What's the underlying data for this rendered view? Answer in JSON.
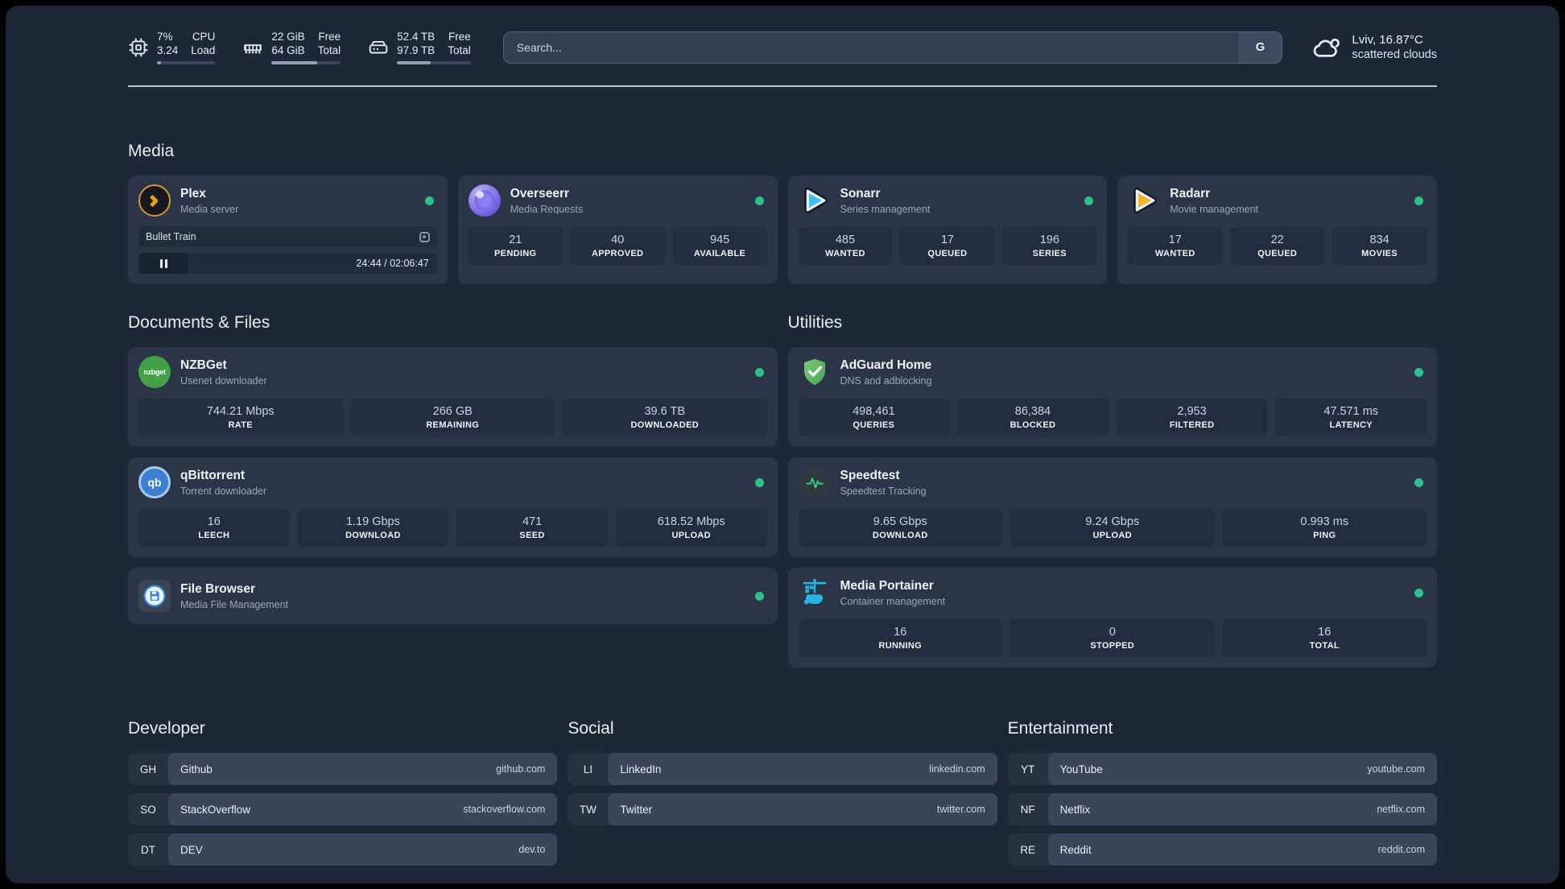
{
  "colors": {
    "status_online": "#2cc08a",
    "plex_accent": "#e5a00d",
    "sonarr_accent": "#38c0f0",
    "radarr_accent": "#f7b32b",
    "adguard_accent": "#5cb85f",
    "portainer_accent": "#29b2e5"
  },
  "header": {
    "resources": [
      {
        "icon": "cpu-icon",
        "value_top": "7%",
        "value_bottom": "3.24",
        "label_top": "CPU",
        "label_bottom": "Load",
        "percent": 7
      },
      {
        "icon": "memory-icon",
        "value_top": "22 GiB",
        "value_bottom": "64 GiB",
        "label_top": "Free",
        "label_bottom": "Total",
        "percent": 66
      },
      {
        "icon": "disk-icon",
        "value_top": "52.4 TB",
        "value_bottom": "97.9 TB",
        "label_top": "Free",
        "label_bottom": "Total",
        "percent": 46
      }
    ],
    "search": {
      "placeholder": "Search...",
      "provider_initial": "G"
    },
    "weather": {
      "location_temp": "Lviv, 16.87°C",
      "condition": "scattered clouds"
    }
  },
  "groups": [
    {
      "title": "Media",
      "services": [
        {
          "name": "Plex",
          "description": "Media server",
          "status": "online",
          "player": {
            "title": "Bullet Train",
            "time": "24:44 / 02:06:47"
          }
        },
        {
          "name": "Overseerr",
          "description": "Media Requests",
          "status": "online",
          "stats": [
            {
              "value": "21",
              "label": "PENDING"
            },
            {
              "value": "40",
              "label": "APPROVED"
            },
            {
              "value": "945",
              "label": "AVAILABLE"
            }
          ]
        },
        {
          "name": "Sonarr",
          "description": "Series management",
          "status": "online",
          "stats": [
            {
              "value": "485",
              "label": "WANTED"
            },
            {
              "value": "17",
              "label": "QUEUED"
            },
            {
              "value": "196",
              "label": "SERIES"
            }
          ]
        },
        {
          "name": "Radarr",
          "description": "Movie management",
          "status": "online",
          "stats": [
            {
              "value": "17",
              "label": "WANTED"
            },
            {
              "value": "22",
              "label": "QUEUED"
            },
            {
              "value": "834",
              "label": "MOVIES"
            }
          ]
        }
      ]
    },
    {
      "title": "Documents & Files",
      "services": [
        {
          "name": "NZBGet",
          "description": "Usenet downloader",
          "status": "online",
          "stats": [
            {
              "value": "744.21 Mbps",
              "label": "RATE"
            },
            {
              "value": "266 GB",
              "label": "REMAINING"
            },
            {
              "value": "39.6 TB",
              "label": "DOWNLOADED"
            }
          ]
        },
        {
          "name": "qBittorrent",
          "description": "Torrent downloader",
          "status": "online",
          "stats": [
            {
              "value": "16",
              "label": "LEECH"
            },
            {
              "value": "1.19 Gbps",
              "label": "DOWNLOAD"
            },
            {
              "value": "471",
              "label": "SEED"
            },
            {
              "value": "618.52 Mbps",
              "label": "UPLOAD"
            }
          ]
        },
        {
          "name": "File Browser",
          "description": "Media File Management",
          "status": "online",
          "stats": []
        }
      ]
    },
    {
      "title": "Utilities",
      "services": [
        {
          "name": "AdGuard Home",
          "description": "DNS and adblocking",
          "status": "online",
          "stats": [
            {
              "value": "498,461",
              "label": "QUERIES"
            },
            {
              "value": "86,384",
              "label": "BLOCKED"
            },
            {
              "value": "2,953",
              "label": "FILTERED"
            },
            {
              "value": "47.571 ms",
              "label": "LATENCY"
            }
          ]
        },
        {
          "name": "Speedtest",
          "description": "Speedtest Tracking",
          "status": "online",
          "stats": [
            {
              "value": "9.65 Gbps",
              "label": "DOWNLOAD"
            },
            {
              "value": "9.24 Gbps",
              "label": "UPLOAD"
            },
            {
              "value": "0.993 ms",
              "label": "PING"
            }
          ]
        },
        {
          "name": "Media Portainer",
          "description": "Container management",
          "status": "online",
          "stats": [
            {
              "value": "16",
              "label": "RUNNING"
            },
            {
              "value": "0",
              "label": "STOPPED"
            },
            {
              "value": "16",
              "label": "TOTAL"
            }
          ]
        }
      ]
    }
  ],
  "bookmarks": [
    {
      "title": "Developer",
      "links": [
        {
          "abbr": "GH",
          "name": "Github",
          "url": "github.com"
        },
        {
          "abbr": "SO",
          "name": "StackOverflow",
          "url": "stackoverflow.com"
        },
        {
          "abbr": "DT",
          "name": "DEV",
          "url": "dev.to"
        }
      ]
    },
    {
      "title": "Social",
      "links": [
        {
          "abbr": "LI",
          "name": "LinkedIn",
          "url": "linkedin.com"
        },
        {
          "abbr": "TW",
          "name": "Twitter",
          "url": "twitter.com"
        }
      ]
    },
    {
      "title": "Entertainment",
      "links": [
        {
          "abbr": "YT",
          "name": "YouTube",
          "url": "youtube.com"
        },
        {
          "abbr": "NF",
          "name": "Netflix",
          "url": "netflix.com"
        },
        {
          "abbr": "RE",
          "name": "Reddit",
          "url": "reddit.com"
        }
      ]
    }
  ]
}
